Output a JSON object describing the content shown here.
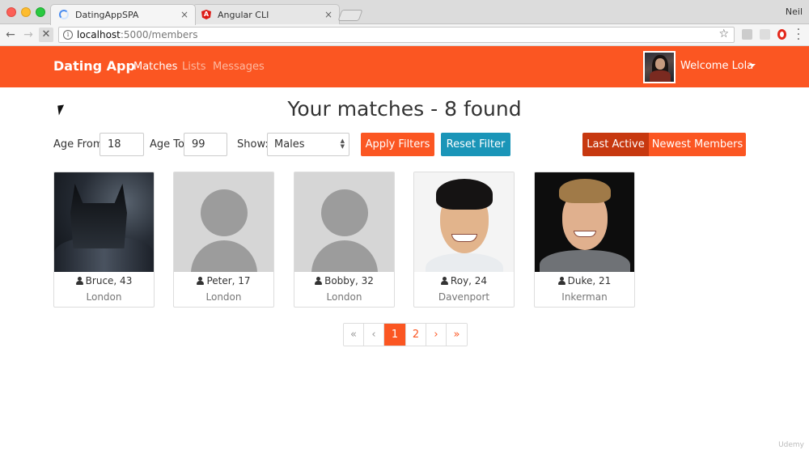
{
  "browser": {
    "tabs": [
      {
        "title": "DatingAppSPA",
        "active": true
      },
      {
        "title": "Angular CLI",
        "active": false
      }
    ],
    "close_glyph": "×",
    "profile_name": "Neil",
    "url_host": "localhost",
    "url_path": ":5000/members"
  },
  "navbar": {
    "brand": "Dating App",
    "links": [
      {
        "label": "Matches",
        "active": true
      },
      {
        "label": "Lists",
        "active": false
      },
      {
        "label": "Messages",
        "active": false
      }
    ],
    "welcome": "Welcome Lola",
    "color": "#fb5622"
  },
  "page": {
    "title": "Your matches - 8 found"
  },
  "filters": {
    "age_from_label": "Age From",
    "age_from_value": "18",
    "age_to_label": "Age To",
    "age_to_value": "99",
    "show_label": "Show:",
    "show_value": "Males",
    "apply_label": "Apply Filters",
    "reset_label": "Reset Filter"
  },
  "sort": {
    "options": [
      "Last Active",
      "Newest Members"
    ],
    "selected": "Last Active"
  },
  "members": [
    {
      "name": "Bruce, 43",
      "city": "London",
      "photo": "photo"
    },
    {
      "name": "Peter, 17",
      "city": "London",
      "photo": "placeholder"
    },
    {
      "name": "Bobby, 32",
      "city": "London",
      "photo": "placeholder"
    },
    {
      "name": "Roy, 24",
      "city": "Davenport",
      "photo": "photo"
    },
    {
      "name": "Duke, 21",
      "city": "Inkerman",
      "photo": "photo"
    }
  ],
  "pagination": {
    "first": "«",
    "prev": "‹",
    "pages": [
      "1",
      "2"
    ],
    "current": "1",
    "next": "›",
    "last": "»"
  },
  "watermark": "Udemy",
  "colors": {
    "primary": "#fb5622",
    "primary_dark": "#c7380f",
    "info": "#1a95b8"
  }
}
